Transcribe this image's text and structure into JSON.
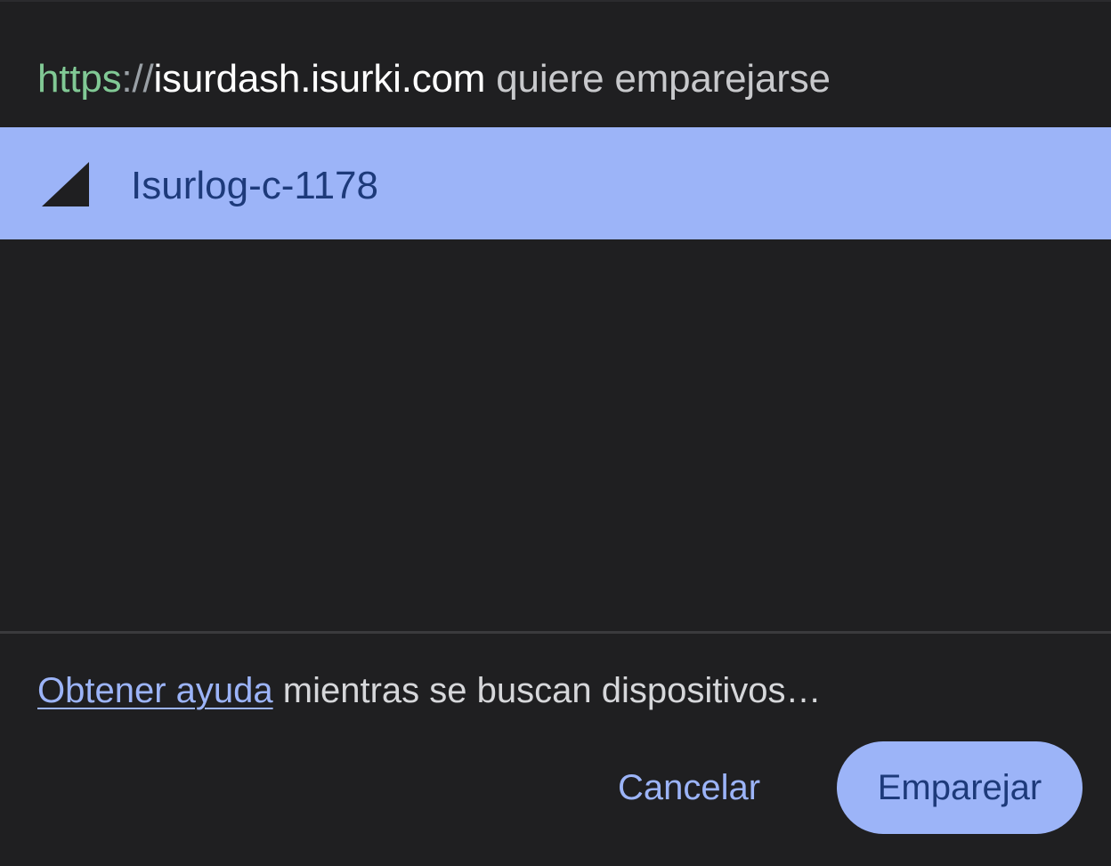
{
  "header": {
    "url_scheme": "https",
    "url_separator": "://",
    "url_host": "isurdash.isurki.com",
    "request_text": " quiere emparejarse"
  },
  "device_list": {
    "items": [
      {
        "name": "Isurlog-c-1178",
        "icon": "signal-strength-icon",
        "selected": true
      }
    ]
  },
  "footer": {
    "help_link_label": "Obtener ayuda",
    "help_status_text": " mientras se buscan dispositivos…",
    "cancel_label": "Cancelar",
    "pair_label": "Emparejar"
  },
  "colors": {
    "background": "#1f1f21",
    "accent": "#9cb4f8",
    "accent_text": "#1d3a7a",
    "secure_scheme": "#81c995"
  }
}
